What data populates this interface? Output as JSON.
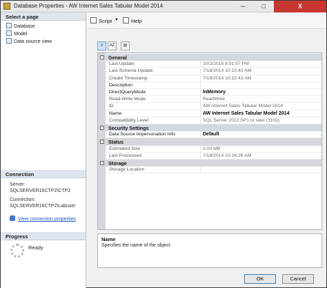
{
  "window": {
    "title": "Database Properties - AW Internet Sales Tabular Model 2014",
    "minimize_glyph": "─",
    "maximize_glyph": "□",
    "close_glyph": "X"
  },
  "left": {
    "select_page_header": "Select a page",
    "pages": [
      {
        "label": "Database"
      },
      {
        "label": "Model"
      },
      {
        "label": "Data source view"
      }
    ],
    "connection_header": "Connection",
    "server_label": "Server:",
    "server_value": "SQLSERVER16CTP2\\CTP2",
    "connection_label": "Connection:",
    "connection_value": "SQLSERVER16CTP2\\Labuser",
    "view_connection_link": "View connection properties",
    "progress_header": "Progress",
    "progress_status": "Ready"
  },
  "toolbar": {
    "script_label": "Script",
    "script_dropdown": "▼",
    "help_label": "Help"
  },
  "property_tools": {
    "categorized_glyph": "≡",
    "alphabetical_glyph": "AZ",
    "pages_glyph": "▤"
  },
  "grid": {
    "collapse_glyph": "−",
    "rows": [
      {
        "kind": "cat",
        "label": "General"
      },
      {
        "kind": "prop",
        "label": "Last Update",
        "value": "10/2/2015 8:51:57 PM"
      },
      {
        "kind": "prop",
        "label": "Last Schema Update",
        "value": "7/18/2014 10:22:43 AM"
      },
      {
        "kind": "prop",
        "label": "Create Timestamp",
        "value": "7/18/2014 10:22:43 AM"
      },
      {
        "kind": "prop",
        "label": "Description",
        "value": "",
        "dark": true
      },
      {
        "kind": "prop",
        "label": "DirectQueryMode",
        "value": "InMemory",
        "bold": true,
        "dark": true
      },
      {
        "kind": "prop",
        "label": "Read-Write Mode",
        "value": "ReadWrite"
      },
      {
        "kind": "prop",
        "label": "ID",
        "value": "AW Internet Sales Tabular Model 2014"
      },
      {
        "kind": "prop",
        "label": "Name",
        "value": "AW Internet Sales Tabular Model 2014",
        "bold": true,
        "dark": true
      },
      {
        "kind": "prop",
        "label": "Compatibility Level",
        "value": "SQL Server 2012 SP1 or later (1103)"
      },
      {
        "kind": "cat",
        "label": "Security Settings"
      },
      {
        "kind": "prop",
        "label": "Data Source Impersonation Info",
        "value": "Default",
        "bold": true,
        "dark": true
      },
      {
        "kind": "cat",
        "label": "Status"
      },
      {
        "kind": "prop",
        "label": "Estimated Size",
        "value": "0.00 MB"
      },
      {
        "kind": "prop",
        "label": "Last Processed",
        "value": "7/18/2014 10:24:26 AM"
      },
      {
        "kind": "cat",
        "label": "Storage"
      },
      {
        "kind": "prop",
        "label": "Storage Location",
        "value": ""
      }
    ]
  },
  "description": {
    "title": "Name",
    "text": "Specifies the name of the object."
  },
  "buttons": {
    "ok": "OK",
    "cancel": "Cancel"
  }
}
